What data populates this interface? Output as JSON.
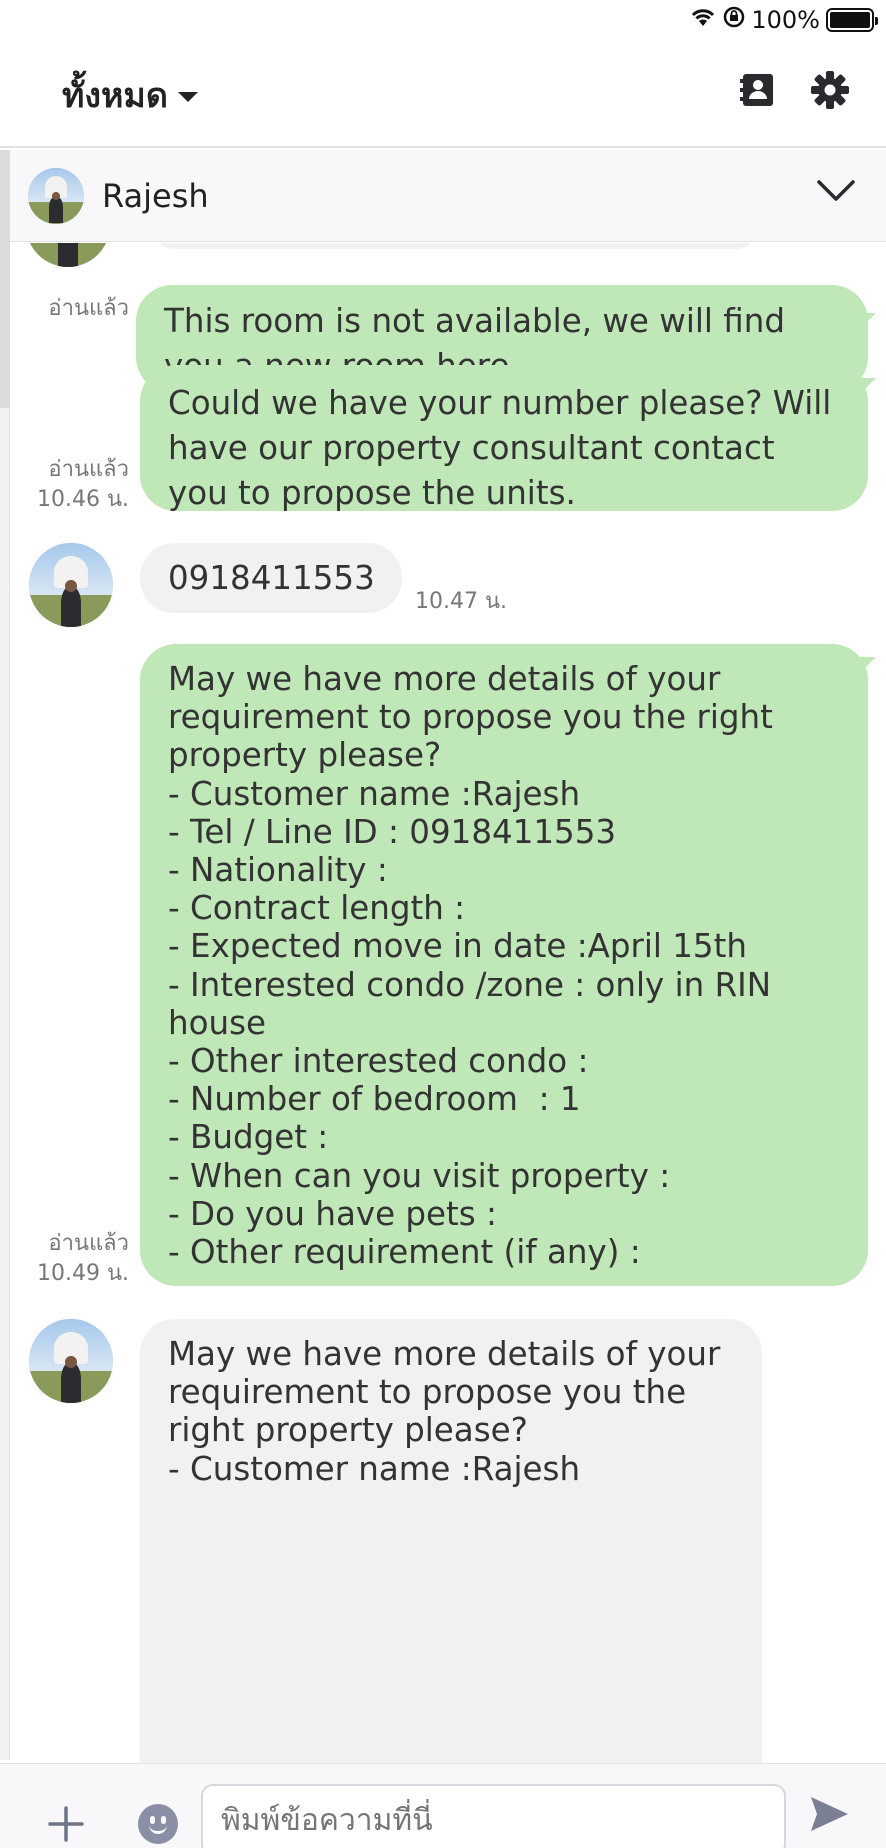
{
  "status_bar": {
    "battery_text": "100%",
    "battery_level": 1.0
  },
  "top_bar": {
    "filter_label": "ทั้งหมด"
  },
  "chat_header": {
    "contact_name": "Rajesh"
  },
  "messages": [
    {
      "type": "sent",
      "text": "This room is not available, we will find\nyou a new room here.",
      "read_label": "อ่านแล้ว",
      "time": ""
    },
    {
      "type": "sent",
      "text": "Could we have your number please? Will\nhave our property consultant contact\nyou to propose the units.",
      "read_label": "อ่านแล้ว",
      "time": "10.46 น."
    },
    {
      "type": "received",
      "text": "0918411553",
      "time": "10.47 น."
    },
    {
      "type": "sent",
      "text": "May we have more details of your\nrequirement to propose you the right\nproperty please?\n- Customer name :Rajesh\n- Tel / Line ID : 0918411553\n- Nationality :\n- Contract length :\n- Expected move in date :April 15th\n- Interested condo /zone : only in RIN\nhouse\n- Other interested condo :\n- Number of bedroom  : 1\n- Budget :\n- When can you visit property :\n- Do you have pets :\n- Other requirement (if any) :",
      "read_label": "อ่านแล้ว",
      "time": "10.49 น."
    },
    {
      "type": "received",
      "text": "May we have more details of your\nrequirement to propose you the\nright property please?\n- Customer name :Rajesh",
      "time": ""
    }
  ],
  "input": {
    "placeholder": "พิมพ์ข้อความที่นี่"
  },
  "colors": {
    "sent_bubble": "#c0e7b7",
    "received_bubble": "#f0f1f3"
  }
}
